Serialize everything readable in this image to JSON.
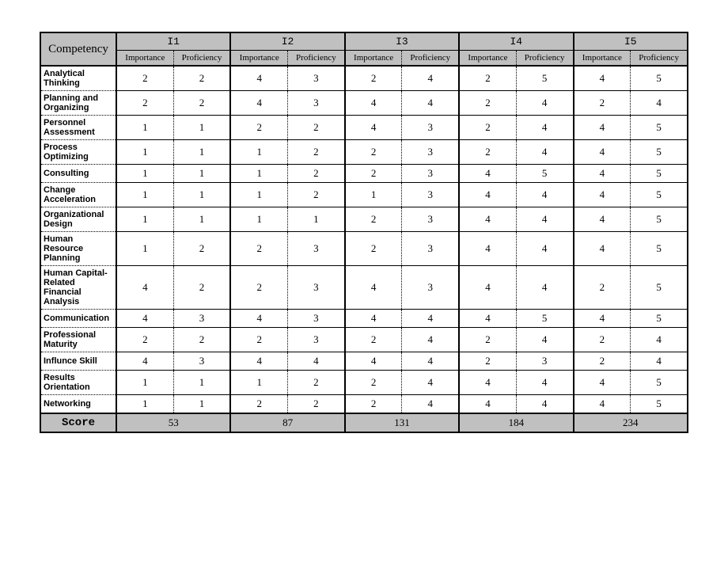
{
  "headers": {
    "competency": "Competency",
    "groups": [
      "I1",
      "I2",
      "I3",
      "I4",
      "I5"
    ],
    "sub": {
      "imp": "Importance",
      "prof": "Proficiency"
    },
    "score": "Score"
  },
  "rows": [
    {
      "name": "Analytical Thinking",
      "v": [
        2,
        2,
        4,
        3,
        2,
        4,
        2,
        5,
        4,
        5
      ]
    },
    {
      "name": "Planning and Organizing",
      "v": [
        2,
        2,
        4,
        3,
        4,
        4,
        2,
        4,
        2,
        4
      ]
    },
    {
      "name": "Personnel Assessment",
      "v": [
        1,
        1,
        2,
        2,
        4,
        3,
        2,
        4,
        4,
        5
      ]
    },
    {
      "name": "Process Optimizing",
      "v": [
        1,
        1,
        1,
        2,
        2,
        3,
        2,
        4,
        4,
        5
      ]
    },
    {
      "name": "Consulting",
      "v": [
        1,
        1,
        1,
        2,
        2,
        3,
        4,
        5,
        4,
        5
      ]
    },
    {
      "name": "Change Acceleration",
      "v": [
        1,
        1,
        1,
        2,
        1,
        3,
        4,
        4,
        4,
        5
      ]
    },
    {
      "name": "Organizational Design",
      "v": [
        1,
        1,
        1,
        1,
        2,
        3,
        4,
        4,
        4,
        5
      ]
    },
    {
      "name": "Human Resource Planning",
      "v": [
        1,
        2,
        2,
        3,
        2,
        3,
        4,
        4,
        4,
        5
      ]
    },
    {
      "name": "Human Capital-Related Financial Analysis",
      "v": [
        4,
        2,
        2,
        3,
        4,
        3,
        4,
        4,
        2,
        5
      ]
    },
    {
      "name": "Communication",
      "v": [
        4,
        3,
        4,
        3,
        4,
        4,
        4,
        5,
        4,
        5
      ]
    },
    {
      "name": "Professional Maturity",
      "v": [
        2,
        2,
        2,
        3,
        2,
        4,
        2,
        4,
        2,
        4
      ]
    },
    {
      "name": "Influnce Skill",
      "v": [
        4,
        3,
        4,
        4,
        4,
        4,
        2,
        3,
        2,
        4
      ]
    },
    {
      "name": "Results Orientation",
      "v": [
        1,
        1,
        1,
        2,
        2,
        4,
        4,
        4,
        4,
        5
      ]
    },
    {
      "name": "Networking",
      "v": [
        1,
        1,
        2,
        2,
        2,
        4,
        4,
        4,
        4,
        5
      ]
    }
  ],
  "scores": [
    53,
    87,
    131,
    184,
    234
  ]
}
